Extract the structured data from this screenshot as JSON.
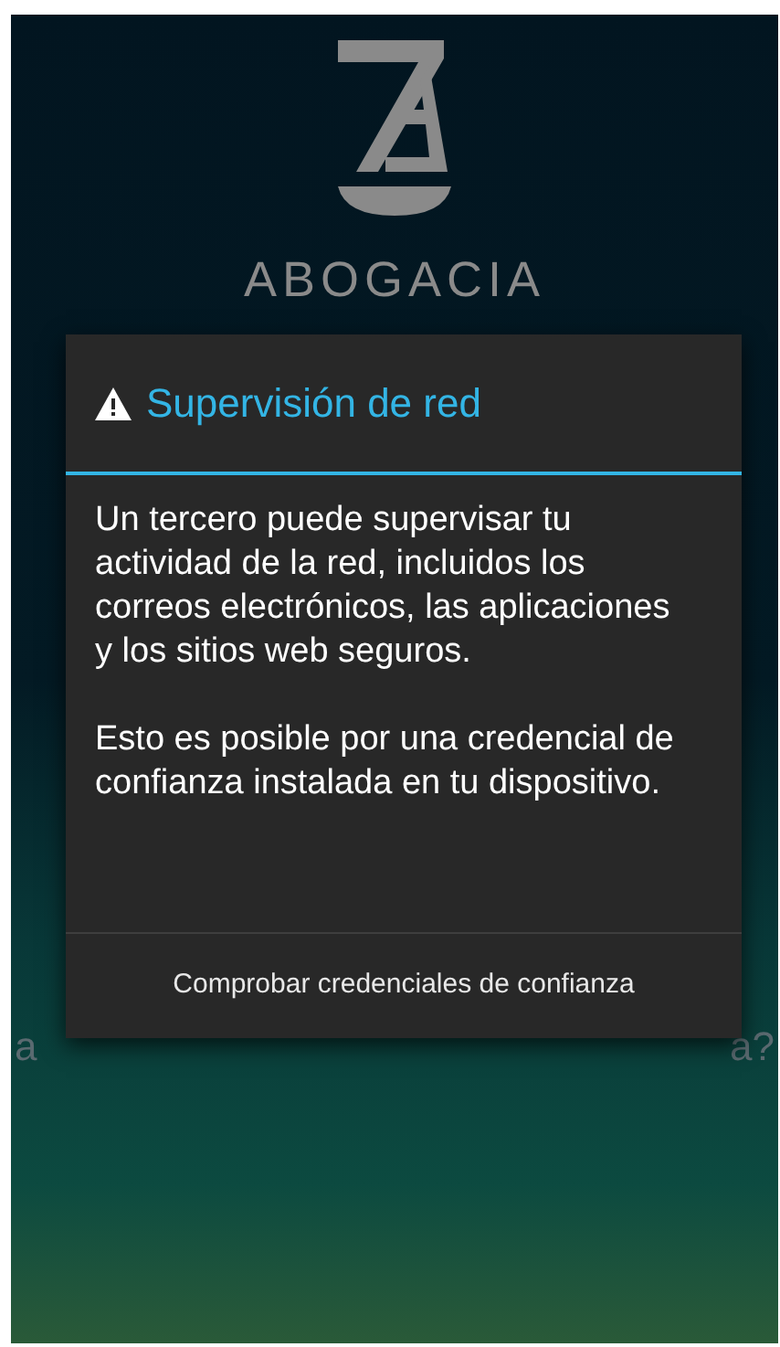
{
  "background": {
    "brand_name": "ABOGACIA",
    "hidden_line_start": "a",
    "hidden_line_end": "a?"
  },
  "dialog": {
    "title": "Supervisión de red",
    "paragraphs": [
      "Un tercero puede supervisar tu actividad de la red, incluidos los correos electrónicos, las aplicaciones y los sitios web seguros.",
      "Esto es posible por una credencial de confianza instalada en tu dispositivo."
    ],
    "button": "Comprobar credenciales de confianza"
  }
}
